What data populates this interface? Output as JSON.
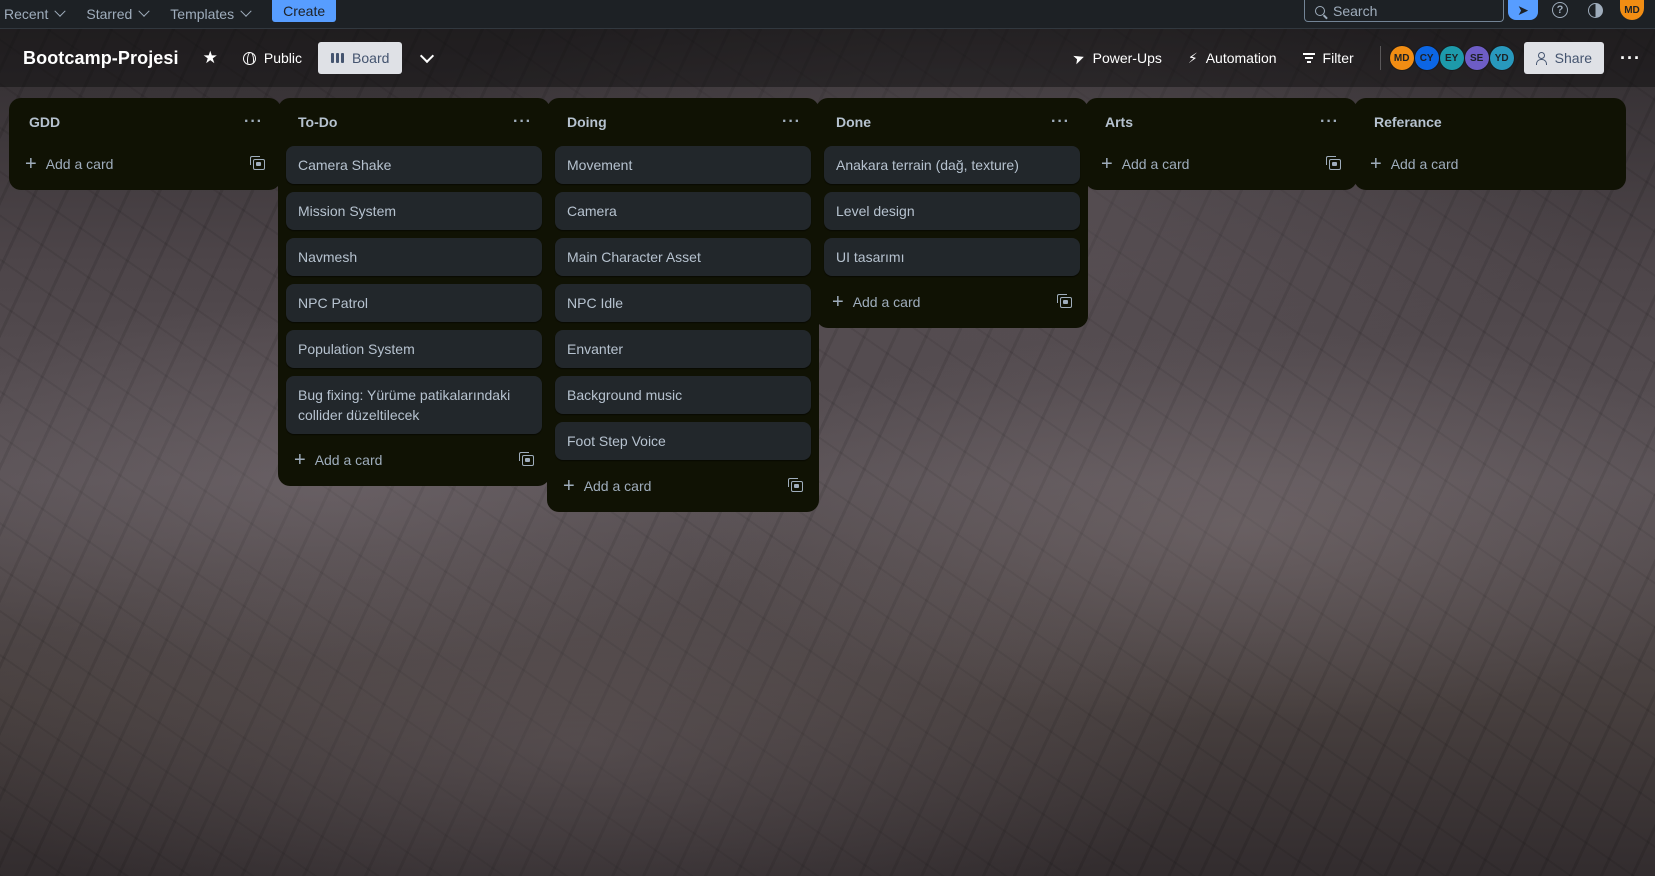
{
  "topnav": {
    "recent": "Recent",
    "starred": "Starred",
    "templates": "Templates",
    "create": "Create",
    "search_placeholder": "Search",
    "user_initials": "MD"
  },
  "board": {
    "title": "Bootcamp-Projesi",
    "visibility": "Public",
    "view": "Board",
    "power_ups": "Power-Ups",
    "automation": "Automation",
    "filter": "Filter",
    "share": "Share",
    "members": [
      {
        "initials": "MD",
        "color": "#f18d13"
      },
      {
        "initials": "CY",
        "color": "#0c66e4"
      },
      {
        "initials": "EY",
        "color": "#1d9aaa"
      },
      {
        "initials": "SE",
        "color": "#6e5dc6"
      },
      {
        "initials": "YD",
        "color": "#2898bd"
      }
    ]
  },
  "lists": [
    {
      "title": "GDD",
      "cards": [],
      "add_label": "Add a card"
    },
    {
      "title": "To-Do",
      "cards": [
        "Camera Shake",
        "Mission System",
        "Navmesh",
        "NPC Patrol",
        "Population System",
        "Bug fixing: Yürüme patikalarındaki collider düzeltilecek"
      ],
      "add_label": "Add a card"
    },
    {
      "title": "Doing",
      "cards": [
        "Movement",
        "Camera",
        "Main Character Asset",
        "NPC Idle",
        "Envanter",
        "Background music",
        "Foot Step Voice"
      ],
      "add_label": "Add a card"
    },
    {
      "title": "Done",
      "cards": [
        "Anakara terrain (dağ, texture)",
        "Level design",
        "UI tasarımı"
      ],
      "add_label": "Add a card"
    },
    {
      "title": "Arts",
      "cards": [],
      "add_label": "Add a card"
    },
    {
      "title": "Referance",
      "cards": [],
      "add_label": "Add a card"
    }
  ]
}
